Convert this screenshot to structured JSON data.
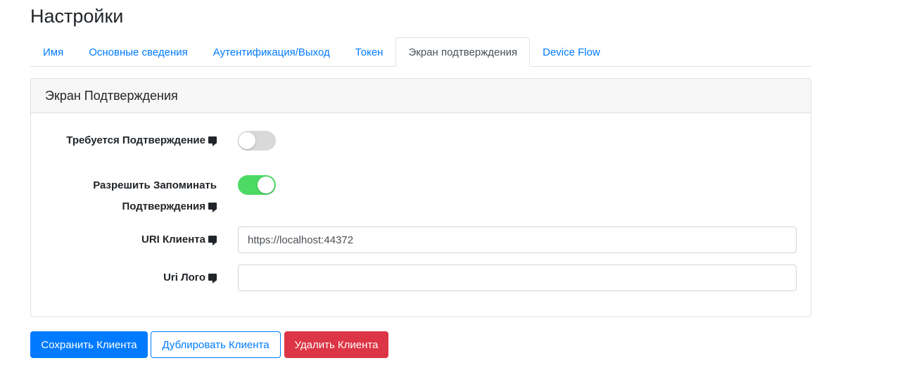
{
  "page": {
    "title": "Настройки"
  },
  "tabs": [
    {
      "label": "Имя",
      "active": false
    },
    {
      "label": "Основные сведения",
      "active": false
    },
    {
      "label": "Аутентификация/Выход",
      "active": false
    },
    {
      "label": "Токен",
      "active": false
    },
    {
      "label": "Экран подтверждения",
      "active": true
    },
    {
      "label": "Device Flow",
      "active": false
    }
  ],
  "card": {
    "header": "Экран Подтверждения",
    "fields": {
      "require_consent": {
        "label": "Требуется Подтверждение",
        "icon": "help-icon",
        "value": false
      },
      "allow_remember": {
        "label_line1": "Разрешить Запоминать",
        "label_line2": "Подтверждения",
        "icon": "help-icon",
        "value": true
      },
      "client_uri": {
        "label": "URI Клиента",
        "icon": "help-icon",
        "value": "https://localhost:44372",
        "placeholder": ""
      },
      "logo_uri": {
        "label": "Uri Лого",
        "icon": "help-icon",
        "value": "",
        "placeholder": ""
      }
    }
  },
  "buttons": {
    "save": "Сохранить Клиента",
    "duplicate": "Дублировать Клиента",
    "delete": "Удалить Клиента"
  },
  "colors": {
    "primary": "#007bff",
    "danger": "#dc3545",
    "toggle_on": "#4cd964",
    "toggle_off": "#d9d9d9"
  }
}
